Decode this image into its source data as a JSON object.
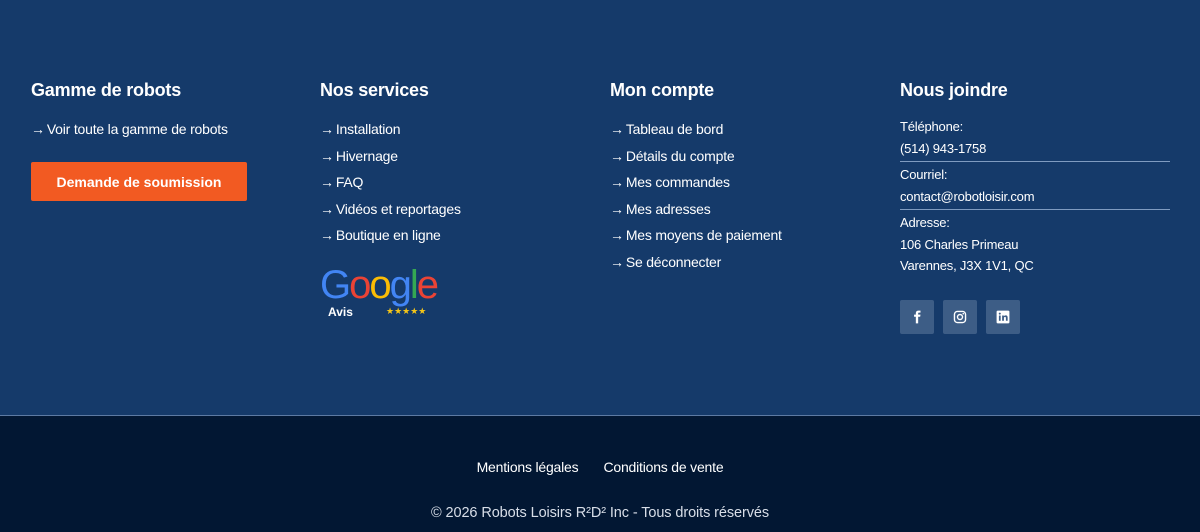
{
  "columns": {
    "robots": {
      "title": "Gamme de robots",
      "links": [
        "Voir toute la gamme de robots"
      ],
      "cta_label": "Demande de soumission"
    },
    "services": {
      "title": "Nos services",
      "links": [
        "Installation",
        "Hivernage",
        "FAQ",
        "Vidéos et reportages",
        "Boutique en ligne"
      ]
    },
    "account": {
      "title": "Mon compte",
      "links": [
        "Tableau de bord",
        "Détails du compte",
        "Mes commandes",
        "Mes adresses",
        "Mes moyens de paiement",
        "Se déconnecter"
      ]
    },
    "contact": {
      "title": "Nous joindre",
      "phone_label": "Téléphone:",
      "phone": "(514) 943-1758",
      "email_label": "Courriel:",
      "email": "contact@robotloisir.com",
      "address_label": "Adresse:",
      "address_line1": "106 Charles Primeau",
      "address_line2": "Varennes, J3X 1V1, QC"
    }
  },
  "arrow": "→",
  "google_badge": {
    "word": "Google",
    "label": "Avis",
    "stars": "★★★★★",
    "colors": [
      "#4285F4",
      "#EA4335",
      "#FBBC05",
      "#4285F4",
      "#34A853",
      "#EA4335"
    ]
  },
  "social": [
    "facebook-icon",
    "instagram-icon",
    "linkedin-icon"
  ],
  "legal_links": [
    "Mentions légales",
    "Conditions de vente"
  ],
  "copyright": "© 2026 Robots Loisirs R²D² Inc - Tous droits réservés",
  "colors": {
    "footer_top": "#153a6a",
    "footer_bottom": "#021733",
    "cta": "#f25a22",
    "social_bg": "#3d5d86"
  }
}
